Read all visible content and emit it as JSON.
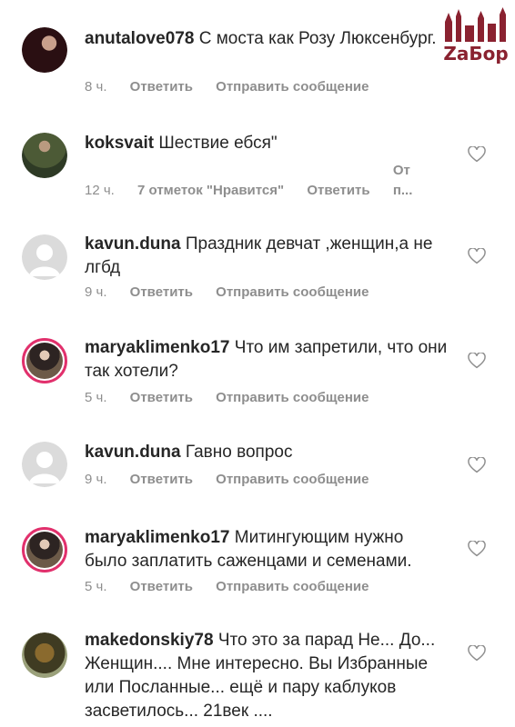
{
  "logo": {
    "text": "ZaБор",
    "color": "#8a2230"
  },
  "comments": [
    {
      "user": "anutalove078",
      "text": "С моста как Розу Люксенбург.",
      "time": "8 ч.",
      "reply": "Ответить",
      "send": "Отправить сообщение"
    },
    {
      "user": "koksvait",
      "text": "Шествие ебся\"",
      "time": "12 ч.",
      "likes": "7 отметок \"Нравится\"",
      "reply": "Ответить",
      "send": "От п..."
    },
    {
      "user": "kavun.duna",
      "text": "Праздник девчат ,женщин,а не лгбд",
      "time": "9 ч.",
      "reply": "Ответить",
      "send": "Отправить сообщение"
    },
    {
      "user": "maryaklimenko17",
      "text": "Что им запретили, что они так хотели?",
      "time": "5 ч.",
      "reply": "Ответить",
      "send": "Отправить сообщение"
    },
    {
      "user": "kavun.duna",
      "text": "Гавно вопрос",
      "time": "9 ч.",
      "reply": "Ответить",
      "send": "Отправить сообщение"
    },
    {
      "user": "maryaklimenko17",
      "text": "Митингующим нужно было заплатить саженцами и семенами.",
      "time": "5 ч.",
      "reply": "Ответить",
      "send": "Отправить сообщение"
    },
    {
      "user": "makedonskiy78",
      "text": "Что это за парад Не... До... Женщин.... Мне интересно. Вы Избранные или Посланные... ещё и пару каблуков засветилось... 21век ...."
    }
  ]
}
